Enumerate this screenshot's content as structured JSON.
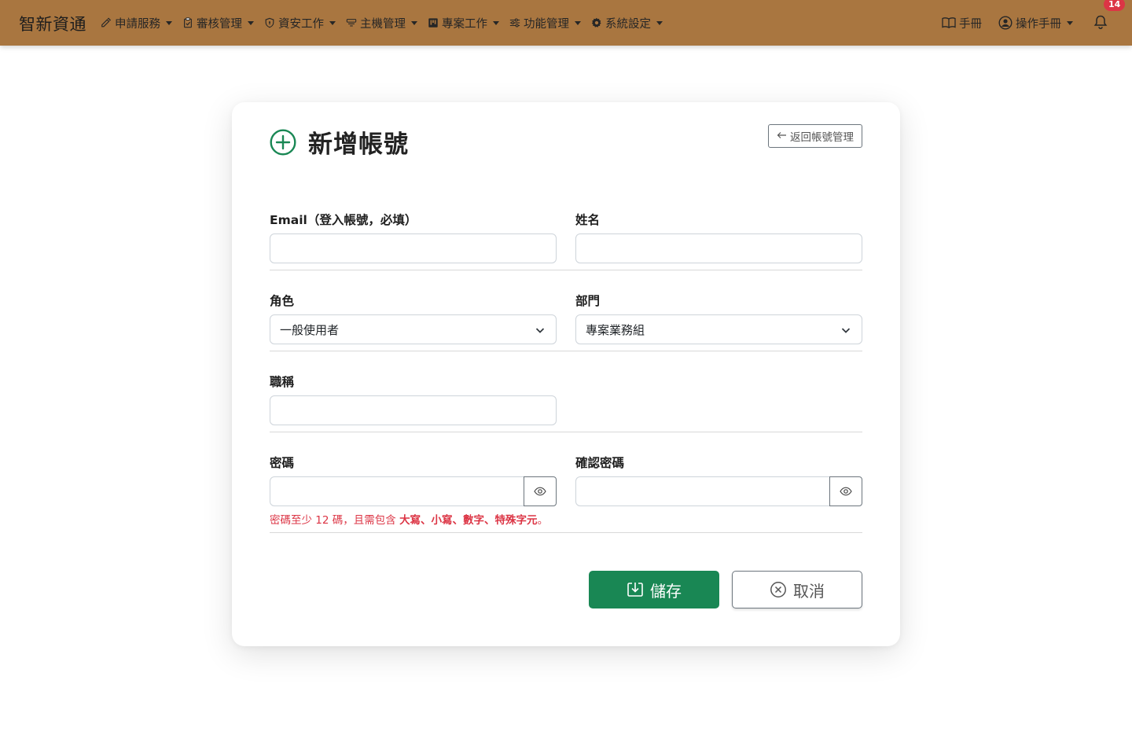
{
  "nav": {
    "bg": "#a97640",
    "brand": "智新資通",
    "items": [
      {
        "label": "申請服務",
        "icon": "edit-icon"
      },
      {
        "label": "審核管理",
        "icon": "clipboard-check-icon"
      },
      {
        "label": "資安工作",
        "icon": "shield-icon"
      },
      {
        "label": "主機管理",
        "icon": "server-icon"
      },
      {
        "label": "專案工作",
        "icon": "kanban-icon"
      },
      {
        "label": "功能管理",
        "icon": "sliders-icon"
      },
      {
        "label": "系統設定",
        "icon": "gear-icon"
      }
    ],
    "manual_label": "手冊",
    "user_label": "操作手冊",
    "notification_count": "14"
  },
  "page": {
    "title": "新增帳號",
    "back_label": "返回帳號管理"
  },
  "form": {
    "email_label": "Email（登入帳號，必填）",
    "email_value": "",
    "name_label": "姓名",
    "name_value": "",
    "role_label": "角色",
    "role_value": "一般使用者",
    "dept_label": "部門",
    "dept_value": "專案業務組",
    "title_label": "職稱",
    "title_value": "",
    "password_label": "密碼",
    "password_value": "",
    "confirm_label": "確認密碼",
    "confirm_value": "",
    "hint_prefix": "密碼至少 12 碼，且需包含 ",
    "hint_terms": "大寫、小寫、數字、特殊字元",
    "hint_suffix": "。",
    "save_label": "儲存",
    "cancel_label": "取消"
  },
  "colors": {
    "accent": "#198754",
    "danger": "#dc3545"
  }
}
